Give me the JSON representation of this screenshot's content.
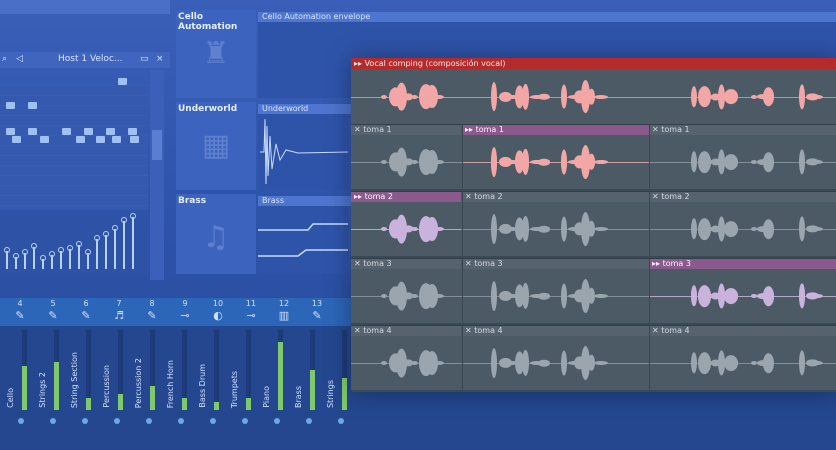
{
  "piano_roll": {
    "toolbar_label": "Host 1  Veloc..."
  },
  "channels": [
    {
      "name": "Cello Automation",
      "clip": "Cello Automation envelope"
    },
    {
      "name": "Underworld",
      "clip": "Underworld"
    },
    {
      "name": "Brass",
      "clip": "Brass"
    }
  ],
  "mixer": {
    "numbers": [
      "4",
      "5",
      "6",
      "7",
      "8",
      "9",
      "10",
      "11",
      "12",
      "13"
    ],
    "tracks": [
      "Cello",
      "Strings 2",
      "String Section",
      "Percussion",
      "Percussion 2",
      "French Horn",
      "Bass Drum",
      "Trumpets",
      "Piano",
      "Brass",
      "Strings"
    ],
    "levels": [
      0.55,
      0.6,
      0.15,
      0.2,
      0.3,
      0.15,
      0.1,
      0.15,
      0.85,
      0.5,
      0.4
    ]
  },
  "playlist": {
    "title": "Vocal comping (composición vocal)",
    "lanes": [
      {
        "segments": [
          {
            "label": "toma 1",
            "selected": false
          },
          {
            "label": "toma 1",
            "selected": true
          },
          {
            "label": "toma 1",
            "selected": false
          }
        ],
        "wave_color": "#f2a6a6"
      },
      {
        "segments": [
          {
            "label": "toma 2",
            "selected": true
          },
          {
            "label": "toma 2",
            "selected": false
          },
          {
            "label": "toma 2",
            "selected": false
          }
        ],
        "wave_color": "#c9b2dc"
      },
      {
        "segments": [
          {
            "label": "toma 3",
            "selected": false
          },
          {
            "label": "toma 3",
            "selected": false
          },
          {
            "label": "toma 3",
            "selected": true
          }
        ],
        "wave_color": "#c9b2dc"
      },
      {
        "segments": [
          {
            "label": "toma 4",
            "selected": false
          },
          {
            "label": "toma 4",
            "selected": false
          },
          {
            "label": "toma 4",
            "selected": false
          }
        ],
        "wave_color": "#aeb8c0"
      }
    ]
  },
  "colors": {
    "accent_red": "#b52b2b",
    "selected_take": "#8a5a8c",
    "comp_wave": "#f2a6a6"
  }
}
